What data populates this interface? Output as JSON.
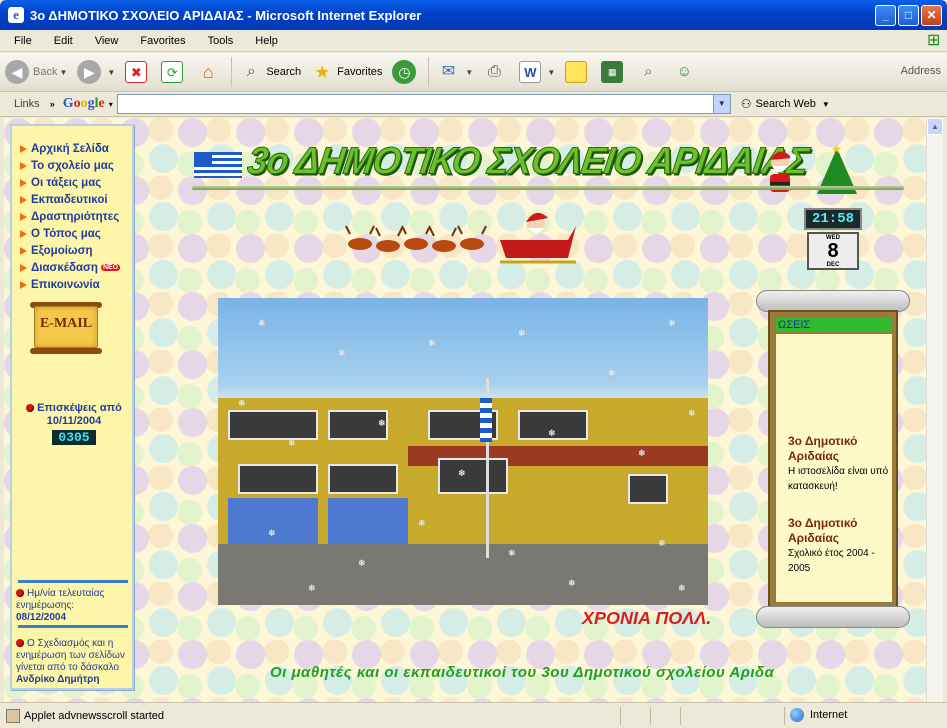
{
  "window": {
    "title": "3ο ΔΗΜΟΤΙΚΟ ΣΧΟΛΕΙΟ ΑΡΙΔΑΙΑΣ - Microsoft Internet Explorer"
  },
  "menu": [
    "File",
    "Edit",
    "View",
    "Favorites",
    "Tools",
    "Help"
  ],
  "toolbar": {
    "back": "Back",
    "search": "Search",
    "favorites": "Favorites",
    "address": "Address"
  },
  "linksbar": {
    "links": "Links",
    "google": "Google",
    "search_web": "Search Web"
  },
  "sidebar": {
    "items": [
      {
        "label": "Αρχική Σελίδα"
      },
      {
        "label": "Το σχολείο μας"
      },
      {
        "label": "Οι τάξεις μας"
      },
      {
        "label": "Εκπαιδευτικοί"
      },
      {
        "label": "Δραστηριότητες"
      },
      {
        "label": "Ο Τόπος μας"
      },
      {
        "label": "Εξομοίωση"
      },
      {
        "label": "Διασκέδαση"
      },
      {
        "label": "Επικοινωνία"
      }
    ],
    "neo_badge": "NEO",
    "email_label": "E-MAIL",
    "visits_label": "Επισκέψεις από",
    "visits_date": "10/11/2004",
    "visits_count": "0305",
    "updated_label": "Ημ/νία τελευταίας ενημέρωσης:",
    "updated_date": "08/12/2004",
    "credit_text": "Ο Σχεδιασμός και η ενημέρωση των σελίδων γίνεται από το δάσκαλο",
    "credit_name": "Ανδρίκο Δημήτρη"
  },
  "banner": {
    "title": "3ο ΔΗΜΟΤΙΚΟ ΣΧΟΛΕΙΟ ΑΡΙΔΑΙΑΣ"
  },
  "clock": {
    "time": "21:58",
    "weekday": "WED",
    "day": "8",
    "month": "DEC"
  },
  "greeting": "ΧΡΟΝΙΑ ΠΟΛΛ.",
  "news": {
    "header": "ΩΣΕΙΣ",
    "items": [
      {
        "title": "3ο Δημοτικό Αριδαίας",
        "text": "Η ιστοσελίδα είναι υπό κατασκευή!"
      },
      {
        "title": "3ο Δημοτικό Αριδαίας",
        "text": "Σχολικό έτος 2004 - 2005"
      }
    ]
  },
  "marquee": "Οι μαθητές και οι εκπαιδευτικοί του 3ου Δημοτικού σχολείου Αριδα",
  "status": {
    "text": "Applet advnewsscroll started",
    "zone": "Internet"
  }
}
